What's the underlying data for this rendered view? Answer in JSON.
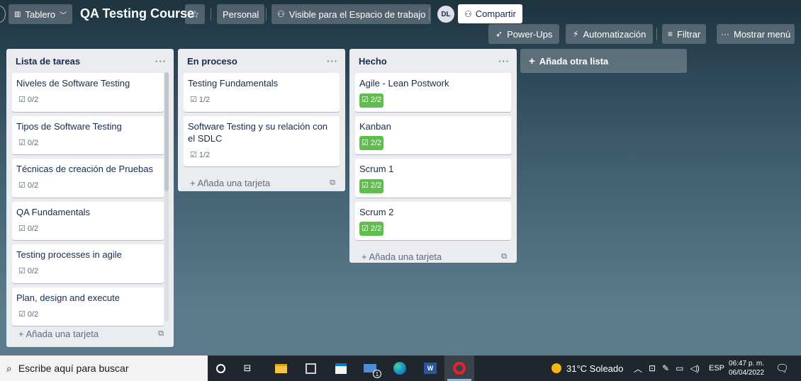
{
  "header": {
    "board_view": "Tablero",
    "board_title": "QA Testing Course",
    "workspace": "Personal",
    "visibility": "Visible para el Espacio de trabajo",
    "avatar_initials": "DL",
    "share": "Compartir",
    "power_ups": "Power-Ups",
    "automation": "Automatización",
    "filter": "Filtrar",
    "show_menu": "Mostrar menú"
  },
  "lists": [
    {
      "title": "Lista de tareas",
      "menu": "···",
      "add_card": "Añada una tarjeta",
      "cards": [
        {
          "title": "Niveles de Software Testing",
          "checklist": "0/2"
        },
        {
          "title": "Tipos de Software Testing",
          "checklist": "0/2"
        },
        {
          "title": "Técnicas de creación de Pruebas",
          "checklist": "0/2"
        },
        {
          "title": "QA Fundamentals",
          "checklist": "0/2"
        },
        {
          "title": "Testing processes in agile",
          "checklist": "0/2"
        },
        {
          "title": "Plan, design and execute",
          "checklist": "0/2"
        }
      ]
    },
    {
      "title": "En proceso",
      "menu": "···",
      "add_card": "Añada una tarjeta",
      "cards": [
        {
          "title": "Testing Fundamentals",
          "checklist": "1/2"
        },
        {
          "title": "Software Testing y su relación con el SDLC",
          "checklist": "1/2"
        }
      ]
    },
    {
      "title": "Hecho",
      "menu": "···",
      "add_card": "Añada una tarjeta",
      "cards": [
        {
          "title": "Agile - Lean Postwork",
          "checklist": "2/2"
        },
        {
          "title": "Kanban",
          "checklist": "2/2"
        },
        {
          "title": "Scrum 1",
          "checklist": "2/2"
        },
        {
          "title": "Scrum 2",
          "checklist": "2/2"
        }
      ]
    }
  ],
  "add_list": "Añada otra lista",
  "taskbar": {
    "search_placeholder": "Escribe aquí para buscar",
    "weather": "31°C  Soleado",
    "language": "ESP",
    "time": "06:47 p. m.",
    "date": "06/04/2022",
    "mail_badge": "1"
  },
  "colors": {
    "done_badge": "#61bd4f",
    "list_bg": "#ebecf0",
    "taskbar": "#20262d"
  }
}
